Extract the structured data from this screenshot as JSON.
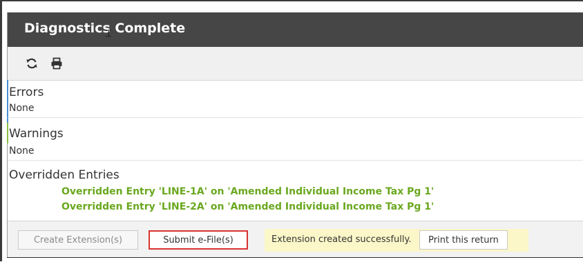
{
  "dialog": {
    "title": "Diagnostics Complete"
  },
  "toolbar": {
    "refresh_icon": "refresh-icon",
    "print_icon": "printer-icon"
  },
  "sections": {
    "errors": {
      "heading": "Errors",
      "value": "None"
    },
    "warnings": {
      "heading": "Warnings",
      "value": "None"
    },
    "overridden": {
      "heading": "Overridden Entries",
      "entries": [
        "Overridden Entry 'LINE-1A' on 'Amended Individual Income Tax Pg 1'",
        "Overridden Entry 'LINE-2A' on 'Amended Individual Income Tax Pg 1'"
      ]
    }
  },
  "footer": {
    "create_extension_label": "Create Extension(s)",
    "submit_efile_label": "Submit e-File(s)",
    "status_message": "Extension created successfully.",
    "print_return_label": "Print this return"
  },
  "colors": {
    "titlebar_bg": "#464646",
    "override_text": "#6aa81f",
    "status_bg": "#fbf7c8",
    "highlight_border": "#d8322f"
  }
}
